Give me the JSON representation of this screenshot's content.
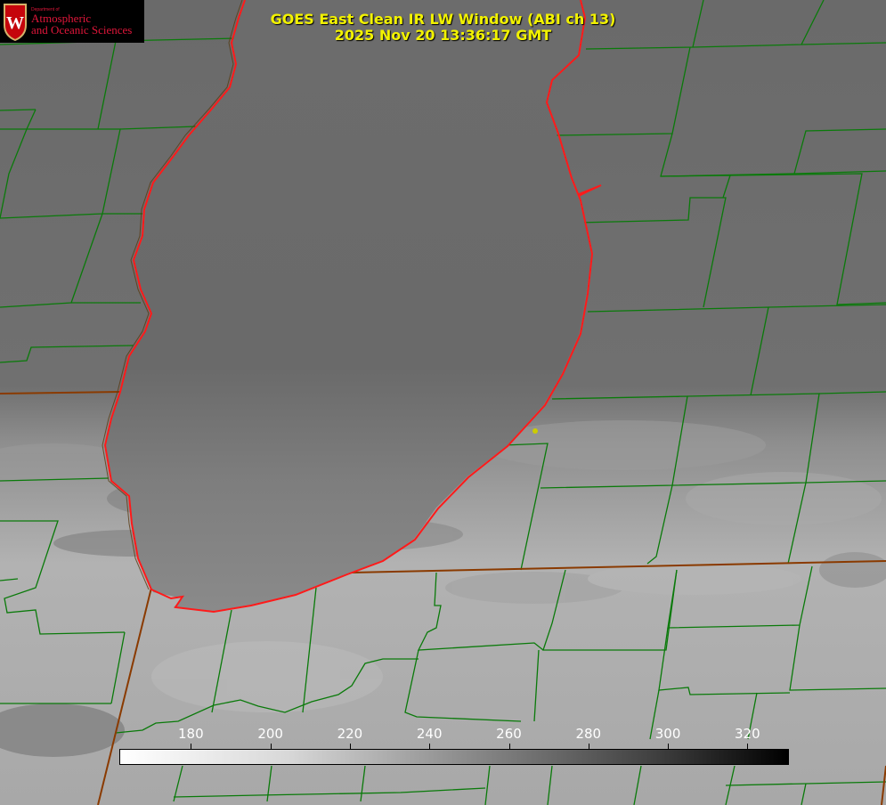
{
  "header": {
    "title": "GOES East Clean IR LW Window (ABI ch 13)",
    "timestamp": "2025 Nov 20 13:36:17 GMT"
  },
  "logo": {
    "department": "Department of",
    "name_line1": "Atmospheric",
    "name_line2": "and Oceanic Sciences",
    "crest_letter": "W",
    "color": "#e0163a"
  },
  "colorbar": {
    "unit_values": [
      180,
      200,
      220,
      240,
      260,
      280,
      300,
      320
    ],
    "labels": [
      "180",
      "200",
      "220",
      "240",
      "260",
      "280",
      "300",
      "320"
    ],
    "range": [
      162,
      330
    ],
    "scale_note": "white = cold, black = warm"
  },
  "overlay": {
    "lake_outline_color": "#ff1a1a",
    "county_line_color": "#0a7a0a",
    "state_line_color": "#8a3a00",
    "marker_color": "#cccc00"
  }
}
